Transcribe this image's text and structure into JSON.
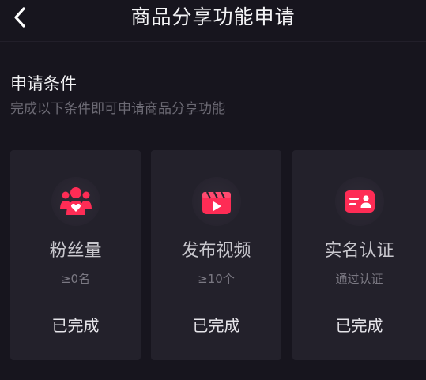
{
  "nav": {
    "title": "商品分享功能申请",
    "back_icon": "chevron-left-icon"
  },
  "section": {
    "title": "申请条件",
    "subtitle": "完成以下条件即可申请商品分享功能"
  },
  "colors": {
    "accent": "#fe2c55",
    "background": "#17151e",
    "card": "#23212b"
  },
  "conditions": [
    {
      "icon": "fans-icon",
      "label": "粉丝量",
      "requirement": "≥0名",
      "status": "已完成"
    },
    {
      "icon": "video-clapper-icon",
      "label": "发布视频",
      "requirement": "≥10个",
      "status": "已完成"
    },
    {
      "icon": "id-card-icon",
      "label": "实名认证",
      "requirement": "通过认证",
      "status": "已完成"
    }
  ]
}
